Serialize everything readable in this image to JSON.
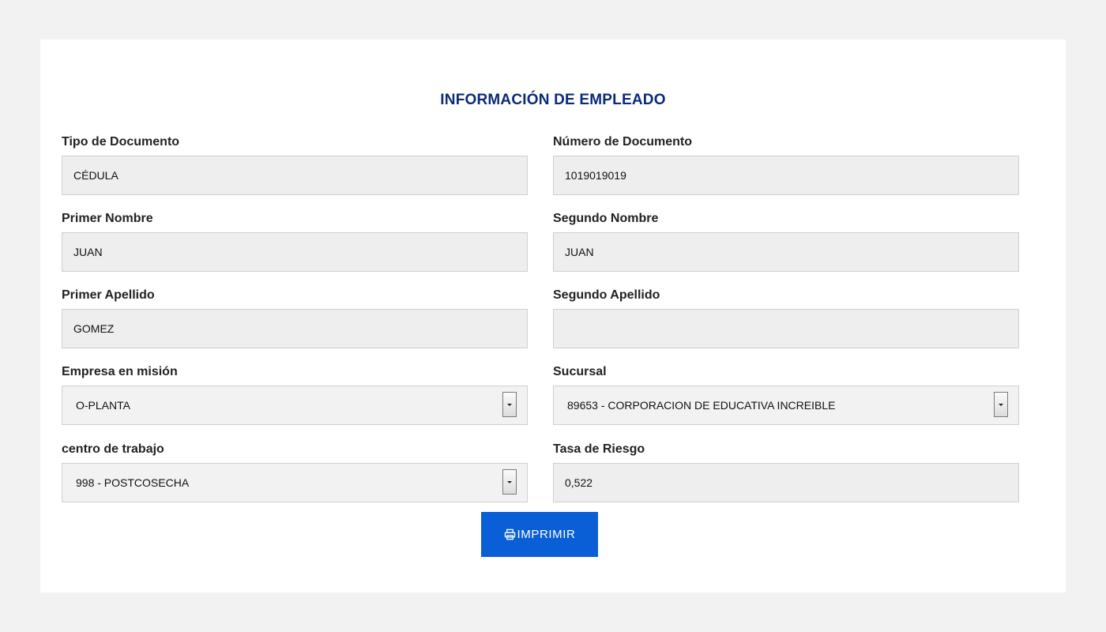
{
  "form": {
    "title": "INFORMACIÓN DE EMPLEADO",
    "fields": {
      "tipo_documento": {
        "label": "Tipo de Documento",
        "value": "CÉDULA"
      },
      "numero_documento": {
        "label": "Número de Documento",
        "value": "1019019019"
      },
      "primer_nombre": {
        "label": "Primer Nombre",
        "value": "JUAN"
      },
      "segundo_nombre": {
        "label": "Segundo Nombre",
        "value": "JUAN"
      },
      "primer_apellido": {
        "label": "Primer Apellido",
        "value": "GOMEZ"
      },
      "segundo_apellido": {
        "label": "Segundo Apellido",
        "value": ""
      },
      "empresa_mision": {
        "label": "Empresa en misión",
        "value": "O-PLANTA"
      },
      "sucursal": {
        "label": "Sucursal",
        "value": "89653 -  CORPORACION DE EDUCATIVA INCREIBLE"
      },
      "centro_trabajo": {
        "label": "centro de trabajo",
        "value": "998 - POSTCOSECHA"
      },
      "tasa_riesgo": {
        "label": "Tasa de Riesgo",
        "value": "0,522"
      }
    },
    "print_button": {
      "label": "IMPRIMIR",
      "icon": "printer-icon"
    }
  },
  "colors": {
    "title": "#0b2a7a",
    "button": "#0a5fd6",
    "background": "#f2f2f2"
  }
}
